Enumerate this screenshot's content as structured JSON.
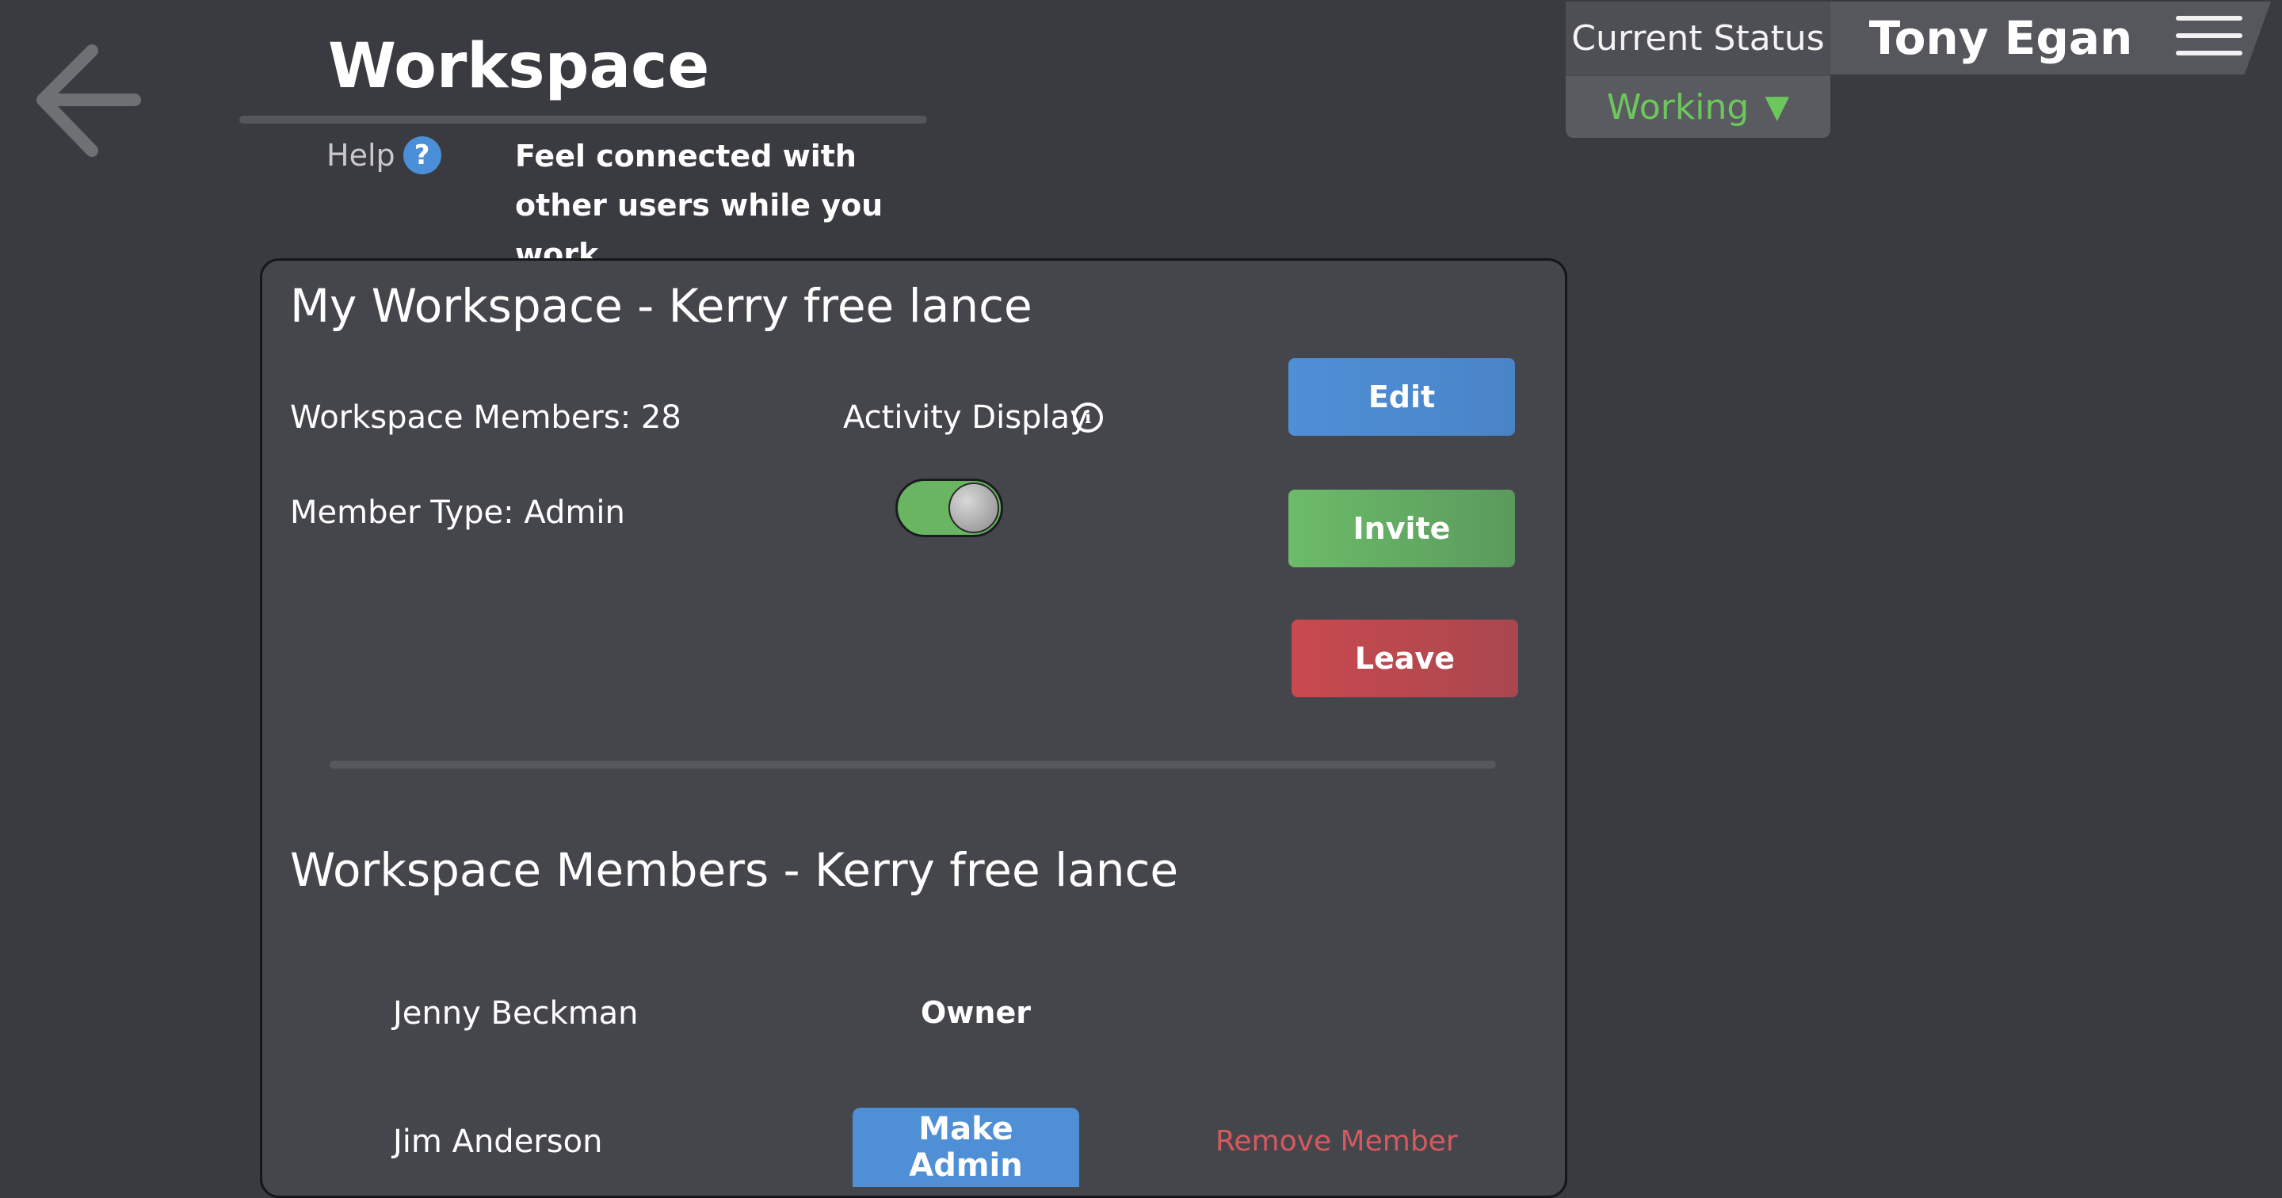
{
  "header": {
    "title": "Workspace",
    "help_label": "Help",
    "help_icon": "?",
    "tagline": "Feel connected with other users while you work"
  },
  "status": {
    "label": "Current Status",
    "value": "Working",
    "caret": "▼",
    "value_color": "#6cc75c"
  },
  "user": {
    "name": "Tony Egan"
  },
  "workspace": {
    "title": "My Workspace - Kerry free lance",
    "members_count": "Workspace Members: 28",
    "member_type": "Member Type: Admin",
    "activity_display_label": "Activity Display",
    "activity_display_on": true,
    "buttons": {
      "edit": "Edit",
      "invite": "Invite",
      "leave": "Leave"
    }
  },
  "members": {
    "title": "Workspace Members - Kerry free lance",
    "rows": [
      {
        "name": "Jenny Beckman",
        "role": "Owner"
      },
      {
        "name": "Jim Anderson",
        "make_admin_label": "Make Admin",
        "remove_label": "Remove Member"
      }
    ]
  },
  "colors": {
    "background": "#3a3b40",
    "card": "#45464c",
    "edit_button": "#4f8fd6",
    "invite_button": "#6cbc69",
    "leave_button": "#c9494f",
    "remove_link": "#d55a5e"
  }
}
